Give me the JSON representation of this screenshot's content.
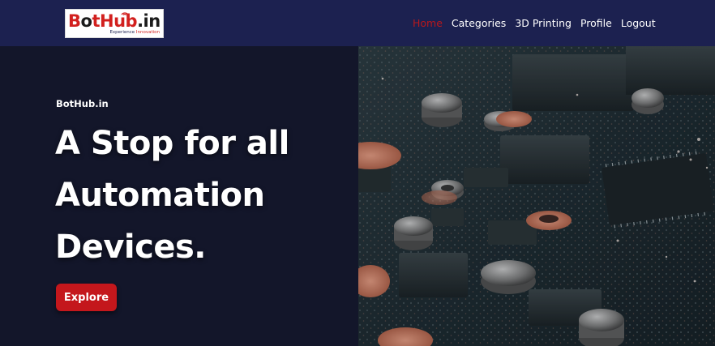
{
  "brand": {
    "logo_text_prefix": "B",
    "logo_text_mid": "tHub",
    "logo_text_suffix": ".in",
    "tagline_part1": "Experience",
    "tagline_part2": "Innovation",
    "colors": {
      "red": "#d2201e",
      "navy": "#1c2150"
    }
  },
  "nav": {
    "items": [
      {
        "label": "Home",
        "active": true
      },
      {
        "label": "Categories",
        "active": false
      },
      {
        "label": "3D Printing",
        "active": false
      },
      {
        "label": "Profile",
        "active": false
      },
      {
        "label": "Logout",
        "active": false
      }
    ]
  },
  "hero": {
    "eyebrow": "BotHub.in",
    "headline_line1": "A Stop for all",
    "headline_line2": "Automation",
    "headline_line3": "Devices.",
    "cta_label": "Explore",
    "image_subject": "circuit-board-photo",
    "colors": {
      "background": "#13162a",
      "cta": "#c4171c"
    }
  }
}
